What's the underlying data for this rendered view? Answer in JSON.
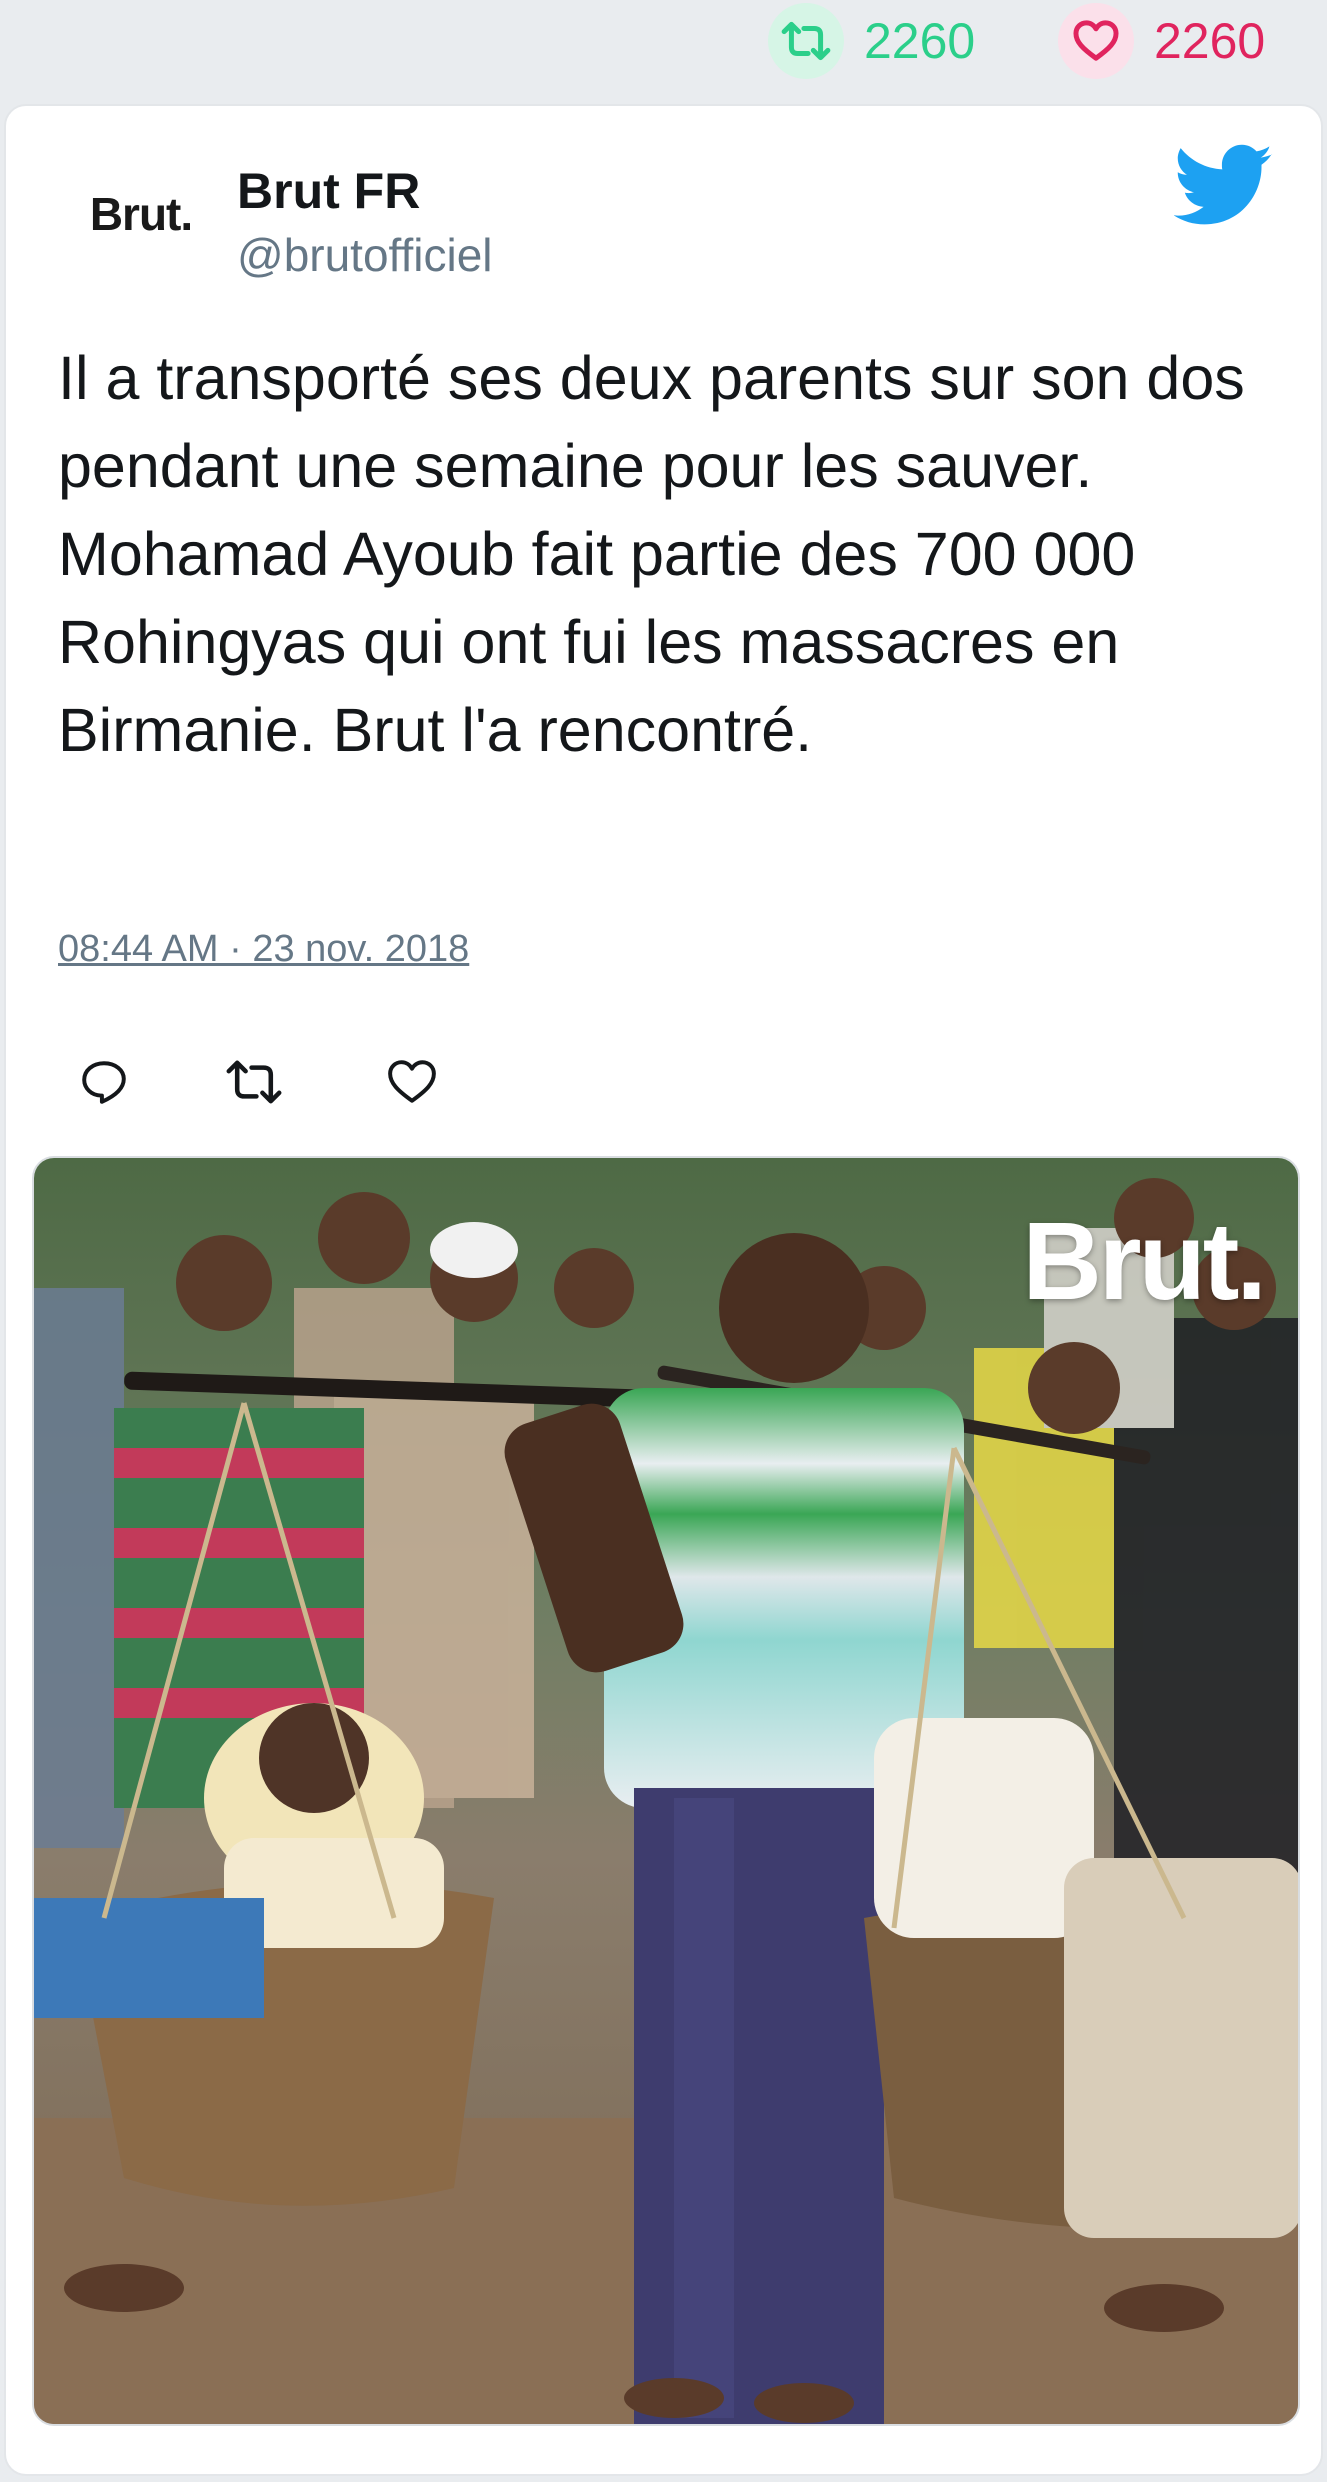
{
  "stats": {
    "retweet_count": "2260",
    "like_count": "2260"
  },
  "author": {
    "avatar_text": "Brut.",
    "name": "Brut FR",
    "handle": "@brutofficiel"
  },
  "tweet": {
    "text": "Il a transporté ses deux parents sur son dos pendant une semaine pour les sauver. Mohamad Ayoub fait partie des 700 000 Rohingyas qui ont fui les massacres en Birmanie. Brut l'a rencontré.",
    "timestamp": "08:44 AM · 23 nov. 2018"
  },
  "media": {
    "watermark": "Brut."
  },
  "icons": {
    "retweet": "retweet-icon",
    "like": "heart-icon",
    "reply": "reply-icon",
    "brand": "twitter-bird-icon"
  },
  "colors": {
    "retweet_green": "#2bcf8a",
    "like_red": "#e0245e",
    "twitter_blue": "#1da1f2",
    "handle_gray": "#657786"
  }
}
